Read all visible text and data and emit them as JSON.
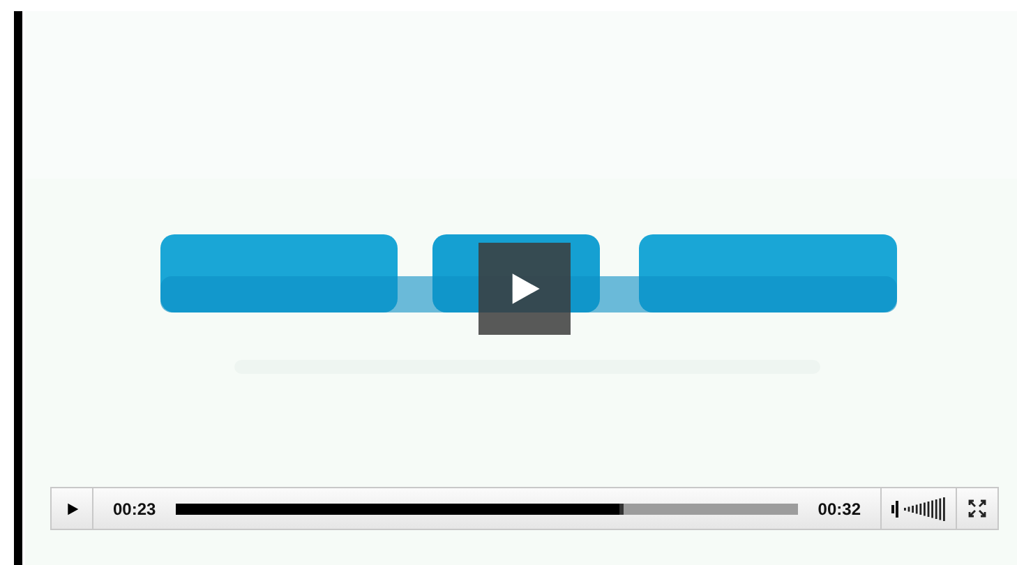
{
  "video": {
    "playing": false
  },
  "controls": {
    "elapsed": "00:23",
    "duration": "00:32",
    "progress": {
      "level": 0.72
    }
  }
}
